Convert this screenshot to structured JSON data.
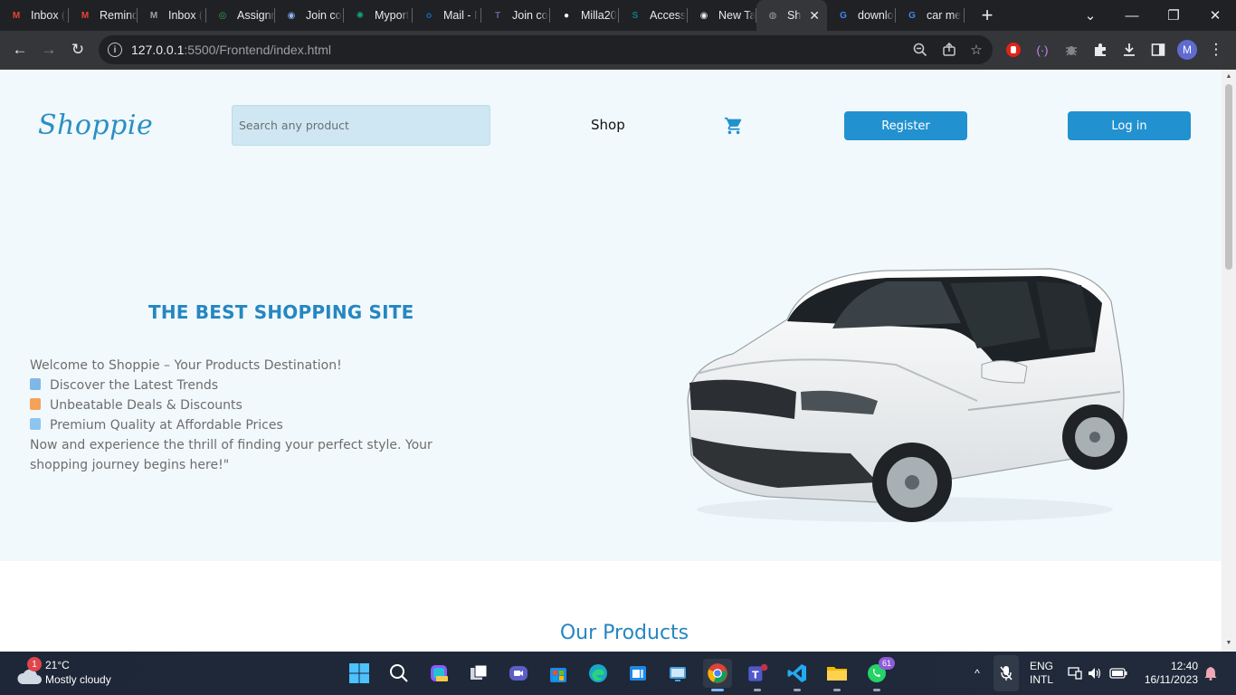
{
  "browser": {
    "tabs": [
      {
        "label": "Inbox (",
        "icon": "gmail-icon",
        "color": "#ea4335"
      },
      {
        "label": "Remind",
        "icon": "gmail-icon",
        "color": "#ea4335"
      },
      {
        "label": "Inbox (",
        "icon": "gmail-icon",
        "color": "#9aa0a6"
      },
      {
        "label": "Assignm",
        "icon": "copilot-icon",
        "color": "#34a853"
      },
      {
        "label": "Join co",
        "icon": "meet-icon",
        "color": "#8ab4f8"
      },
      {
        "label": "Myport",
        "icon": "chatgpt-icon",
        "color": "#10a37f"
      },
      {
        "label": "Mail - I",
        "icon": "outlook-icon",
        "color": "#0f6cbd"
      },
      {
        "label": "Join co",
        "icon": "teams-icon",
        "color": "#6264a7"
      },
      {
        "label": "Milla20",
        "icon": "github-icon",
        "color": "#ffffff"
      },
      {
        "label": "Access",
        "icon": "sharepoint-icon",
        "color": "#038387"
      },
      {
        "label": "New Ta",
        "icon": "chrome-icon",
        "color": "#e8eaed"
      },
      {
        "label": "Sh",
        "icon": "globe-icon",
        "color": "#9aa0a6",
        "active": true
      },
      {
        "label": "downlo",
        "icon": "google-icon",
        "color": "#4285f4"
      },
      {
        "label": "car me",
        "icon": "google-icon",
        "color": "#4285f4"
      }
    ],
    "url_host": "127.0.0.1",
    "url_rest": ":5500/Frontend/index.html",
    "profile_initial": "M"
  },
  "site": {
    "logo": "Shoppie",
    "search_placeholder": "Search any product",
    "nav_shop": "Shop",
    "register_label": "Register",
    "login_label": "Log in",
    "hero_title": "THE BEST SHOPPING SITE",
    "hero_lines": [
      {
        "text": "Welcome to Shoppie – Your Products Destination!",
        "emoji": null
      },
      {
        "text": "Discover the Latest Trends",
        "emoji": "#7fb8e6"
      },
      {
        "text": "Unbeatable Deals & Discounts",
        "emoji": "#f4a259"
      },
      {
        "text": "Premium Quality at Affordable Prices",
        "emoji": "#8ec5f0"
      },
      {
        "text": "Now and experience the thrill of finding your perfect style. Your shopping journey begins here!\"",
        "emoji": null
      }
    ],
    "products_title": "Our Products",
    "accent_color": "#2291d0"
  },
  "taskbar": {
    "weather_temp": "21°C",
    "weather_cond": "Mostly cloudy",
    "weather_badge": "1",
    "lang_1": "ENG",
    "lang_2": "INTL",
    "time": "12:40",
    "date": "16/11/2023",
    "whatsapp_badge": "61"
  }
}
